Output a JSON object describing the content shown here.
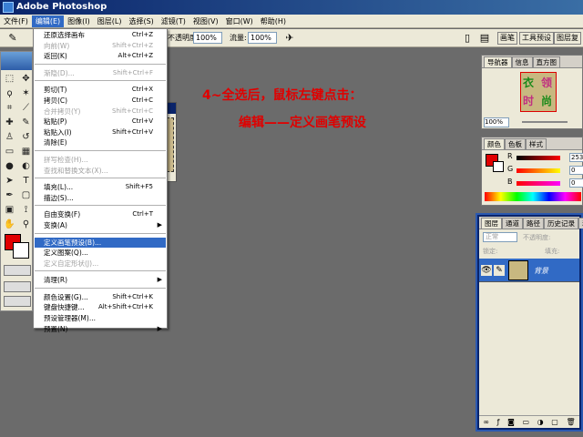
{
  "window": {
    "title": "Adobe Photoshop"
  },
  "menubar": [
    "文件(F)",
    "编辑(E)",
    "图像(I)",
    "图层(L)",
    "选择(S)",
    "滤镜(T)",
    "视图(V)",
    "窗口(W)",
    "帮助(H)"
  ],
  "options": {
    "opacity_label": "不透明度:",
    "opacity_value": "100%",
    "flow_label": "流量:",
    "flow_value": "100%",
    "tabs": [
      "画笔",
      "工具预设",
      "图层复"
    ]
  },
  "edit_menu": {
    "items": [
      {
        "label": "还原选择画布",
        "shortcut": "Ctrl+Z",
        "disabled": false
      },
      {
        "label": "向前(W)",
        "shortcut": "Shift+Ctrl+Z",
        "disabled": true
      },
      {
        "label": "返回(K)",
        "shortcut": "Alt+Ctrl+Z",
        "disabled": false
      },
      {
        "sep": true
      },
      {
        "label": "渐隐(D)...",
        "shortcut": "Shift+Ctrl+F",
        "disabled": true
      },
      {
        "sep": true
      },
      {
        "label": "剪切(T)",
        "shortcut": "Ctrl+X",
        "disabled": false
      },
      {
        "label": "拷贝(C)",
        "shortcut": "Ctrl+C",
        "disabled": false
      },
      {
        "label": "合并拷贝(Y)",
        "shortcut": "Shift+Ctrl+C",
        "disabled": true
      },
      {
        "label": "粘贴(P)",
        "shortcut": "Ctrl+V",
        "disabled": false
      },
      {
        "label": "粘贴入(I)",
        "shortcut": "Shift+Ctrl+V",
        "disabled": false
      },
      {
        "label": "清除(E)",
        "shortcut": "",
        "disabled": false
      },
      {
        "sep": true
      },
      {
        "label": "拼写检查(H)...",
        "shortcut": "",
        "disabled": true
      },
      {
        "label": "查找和替换文本(X)...",
        "shortcut": "",
        "disabled": true
      },
      {
        "sep": true
      },
      {
        "label": "填充(L)...",
        "shortcut": "Shift+F5",
        "disabled": false
      },
      {
        "label": "描边(S)...",
        "shortcut": "",
        "disabled": false
      },
      {
        "sep": true
      },
      {
        "label": "自由变换(F)",
        "shortcut": "Ctrl+T",
        "disabled": false
      },
      {
        "label": "变换(A)",
        "shortcut": "",
        "disabled": false,
        "submenu": true
      },
      {
        "sep": true
      },
      {
        "label": "定义画笔预设(B)...",
        "shortcut": "",
        "disabled": false,
        "highlighted": true
      },
      {
        "label": "定义图案(Q)...",
        "shortcut": "",
        "disabled": false
      },
      {
        "label": "定义自定形状(J)...",
        "shortcut": "",
        "disabled": true
      },
      {
        "sep": true
      },
      {
        "label": "清理(R)",
        "shortcut": "",
        "disabled": false,
        "submenu": true
      },
      {
        "sep": true
      },
      {
        "label": "颜色设置(G)...",
        "shortcut": "Shift+Ctrl+K",
        "disabled": false
      },
      {
        "label": "键盘快捷键...",
        "shortcut": "Alt+Shift+Ctrl+K",
        "disabled": false
      },
      {
        "label": "预设管理器(M)...",
        "shortcut": "",
        "disabled": false
      },
      {
        "label": "预置(N)",
        "shortcut": "",
        "disabled": false,
        "submenu": true
      }
    ]
  },
  "annotation": {
    "line1": "4~全选后，鼠标左键点击：",
    "line2": "编辑——定义画笔预设"
  },
  "navigator": {
    "tabs": [
      "导航器",
      "信息",
      "直方图"
    ],
    "zoom": "100%",
    "thumb_chars": [
      "衣",
      "领",
      "时",
      "尚"
    ]
  },
  "color": {
    "tabs": [
      "颜色",
      "色板",
      "样式"
    ],
    "r_label": "R",
    "g_label": "G",
    "b_label": "B",
    "r_value": "253",
    "g_value": "0",
    "b_value": "0"
  },
  "layers": {
    "tabs": [
      "图层",
      "通道",
      "路径",
      "历史记录",
      "动作"
    ],
    "blend_mode": "正常",
    "opacity_label": "不透明度:",
    "lock_label": "锁定:",
    "fill_label": "填充:",
    "layer_name": "背景"
  },
  "colors": {
    "accent": "#316ac5",
    "annotation": "#e00000",
    "workspace": "#6b6b6b"
  }
}
